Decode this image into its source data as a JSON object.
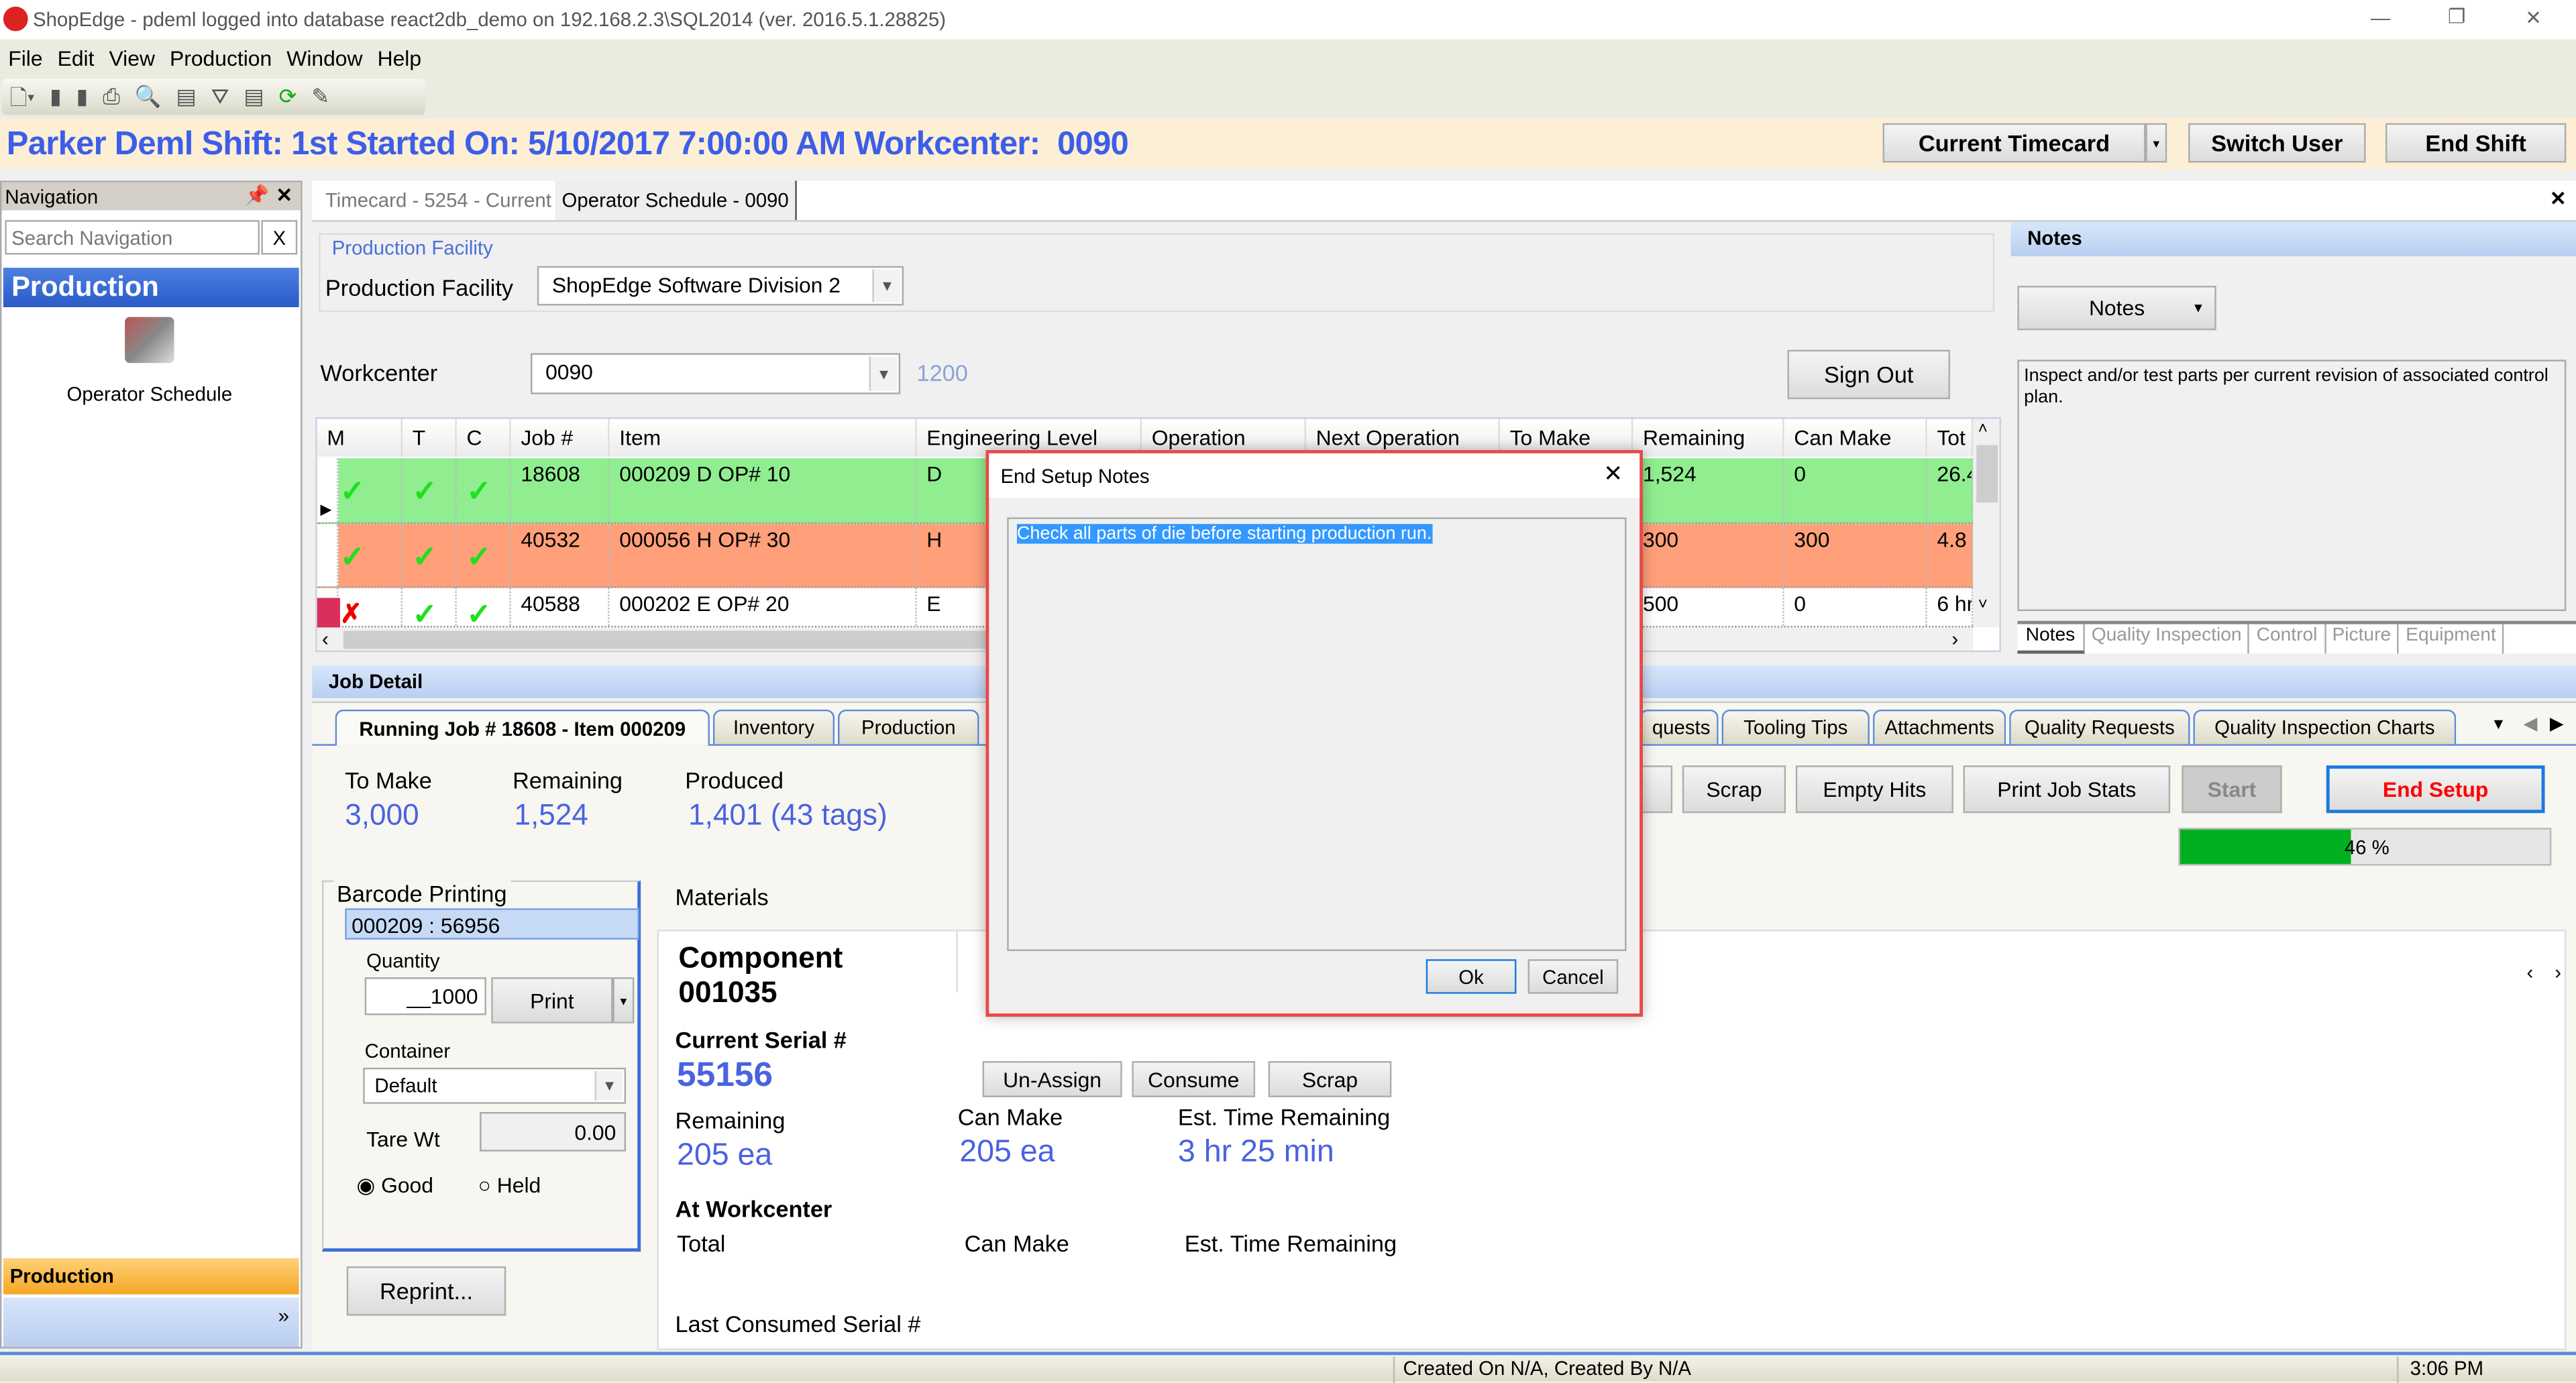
{
  "window": {
    "title": "ShopEdge - pdeml logged into database react2db_demo on 192.168.2.3\\SQL2014 (ver. 2016.5.1.28825)",
    "minimize": "—",
    "restore": "❐",
    "close": "✕"
  },
  "menu": [
    "File",
    "Edit",
    "View",
    "Production",
    "Window",
    "Help"
  ],
  "toolbar": [
    "new-icon",
    "save-icon",
    "save-all-icon",
    "print-icon",
    "print-preview-icon",
    "add-row-icon",
    "filter-icon",
    "remove-row-icon",
    "refresh-icon",
    "edit-icon"
  ],
  "header": {
    "info": "Parker Deml Shift: 1st Started On: 5/10/2017 7:00:00 AM Workcenter:  0090",
    "current_timecard": "Current Timecard",
    "switch_user": "Switch User",
    "end_shift": "End Shift"
  },
  "navigation": {
    "title": "Navigation",
    "search_placeholder": "Search Navigation",
    "clear": "X",
    "section": "Production",
    "item": "Operator Schedule",
    "bottom_section": "Production"
  },
  "doc_tabs": [
    "Timecard - 5254 - Current",
    "Operator Schedule - 0090"
  ],
  "facility": {
    "group": "Production Facility",
    "label": "Production Facility",
    "value": "ShopEdge Software Division 2"
  },
  "workcenter": {
    "label": "Workcenter",
    "value": "0090",
    "extra": "1200",
    "sign_out": "Sign Out"
  },
  "grid": {
    "columns": [
      "M",
      "T",
      "C",
      "Job #",
      "Item",
      "Engineering Level",
      "Operation",
      "Next Operation",
      "To Make",
      "Remaining",
      "Can Make",
      "Tot"
    ],
    "rows": [
      {
        "job": "18608",
        "item": "000209 D OP# 10",
        "eng": "D",
        "remaining": "1,524",
        "can_make": "0",
        "total": "26.4",
        "m": "check",
        "t": "check",
        "c": "check",
        "color": "#90ee90"
      },
      {
        "job": "40532",
        "item": "000056 H OP# 30",
        "eng": "H",
        "remaining": "300",
        "can_make": "300",
        "total": "4.8",
        "m": "check",
        "t": "check",
        "c": "check",
        "color": "#ffa07a"
      },
      {
        "job": "40588",
        "item": "000202 E OP# 20",
        "eng": "E",
        "remaining": "500",
        "can_make": "0",
        "total": "6 hr",
        "m": "cross",
        "t": "check",
        "c": "check",
        "color": "#ffffff"
      }
    ]
  },
  "notes": {
    "title": "Notes",
    "dropdown": "Notes",
    "text": "Inspect and/or test parts per current revision of associated control plan.",
    "tabs": [
      "Notes",
      "Quality Inspection",
      "Control",
      "Picture",
      "Equipment"
    ]
  },
  "job_detail": {
    "title": "Job Detail",
    "tabs_left": [
      "Running Job # 18608 - Item 000209",
      "Inventory",
      "Production"
    ],
    "tabs_right": [
      "quests",
      "Tooling Tips",
      "Attachments",
      "Quality Requests",
      "Quality Inspection Charts"
    ],
    "stats": [
      {
        "label": "To Make",
        "value": "3,000"
      },
      {
        "label": "Remaining",
        "value": "1,524"
      },
      {
        "label": "Produced",
        "value": "1,401 (43 tags)"
      }
    ],
    "buttons": {
      "scrap": "Scrap",
      "empty_hits": "Empty Hits",
      "print_job_stats": "Print Job Stats",
      "start": "Start",
      "end_setup": "End Setup"
    },
    "progress": {
      "percent": 46,
      "label": "46 %"
    }
  },
  "barcode": {
    "title": "Barcode Printing",
    "selected": "000209 : 56956",
    "quantity_label": "Quantity",
    "quantity": "__1000",
    "print": "Print",
    "container_label": "Container",
    "container": "Default",
    "tare_label": "Tare Wt",
    "tare": "0.00",
    "good": "Good",
    "held": "Held",
    "reprint": "Reprint..."
  },
  "materials": {
    "title": "Materials",
    "component": "Component 001035",
    "current_serial_label": "Current Serial #",
    "current_serial": "55156",
    "unassign": "Un-Assign",
    "consume": "Consume",
    "scrap": "Scrap",
    "remaining_label": "Remaining",
    "remaining": "205 ea",
    "can_make_label": "Can Make",
    "can_make": "205 ea",
    "est_label": "Est. Time Remaining",
    "est": "3 hr 25 min",
    "at_wc": "At Workcenter",
    "total_label": "Total",
    "wc_can_make": "Can Make",
    "wc_est": "Est. Time Remaining",
    "last_consumed": "Last Consumed Serial #"
  },
  "dialog": {
    "title": "End Setup Notes",
    "text": "Check all parts of die before starting production run.",
    "ok": "Ok",
    "cancel": "Cancel"
  },
  "status": {
    "created": "Created On N/A, Created By N/A",
    "time": "3:06 PM"
  },
  "colors": {
    "accent": "#3d5ee8",
    "header_bg": "#fdefd6",
    "green_row": "#90ee90",
    "orange_row": "#ffa07a",
    "end_setup": "#ff0000",
    "progress": "#00b020"
  }
}
